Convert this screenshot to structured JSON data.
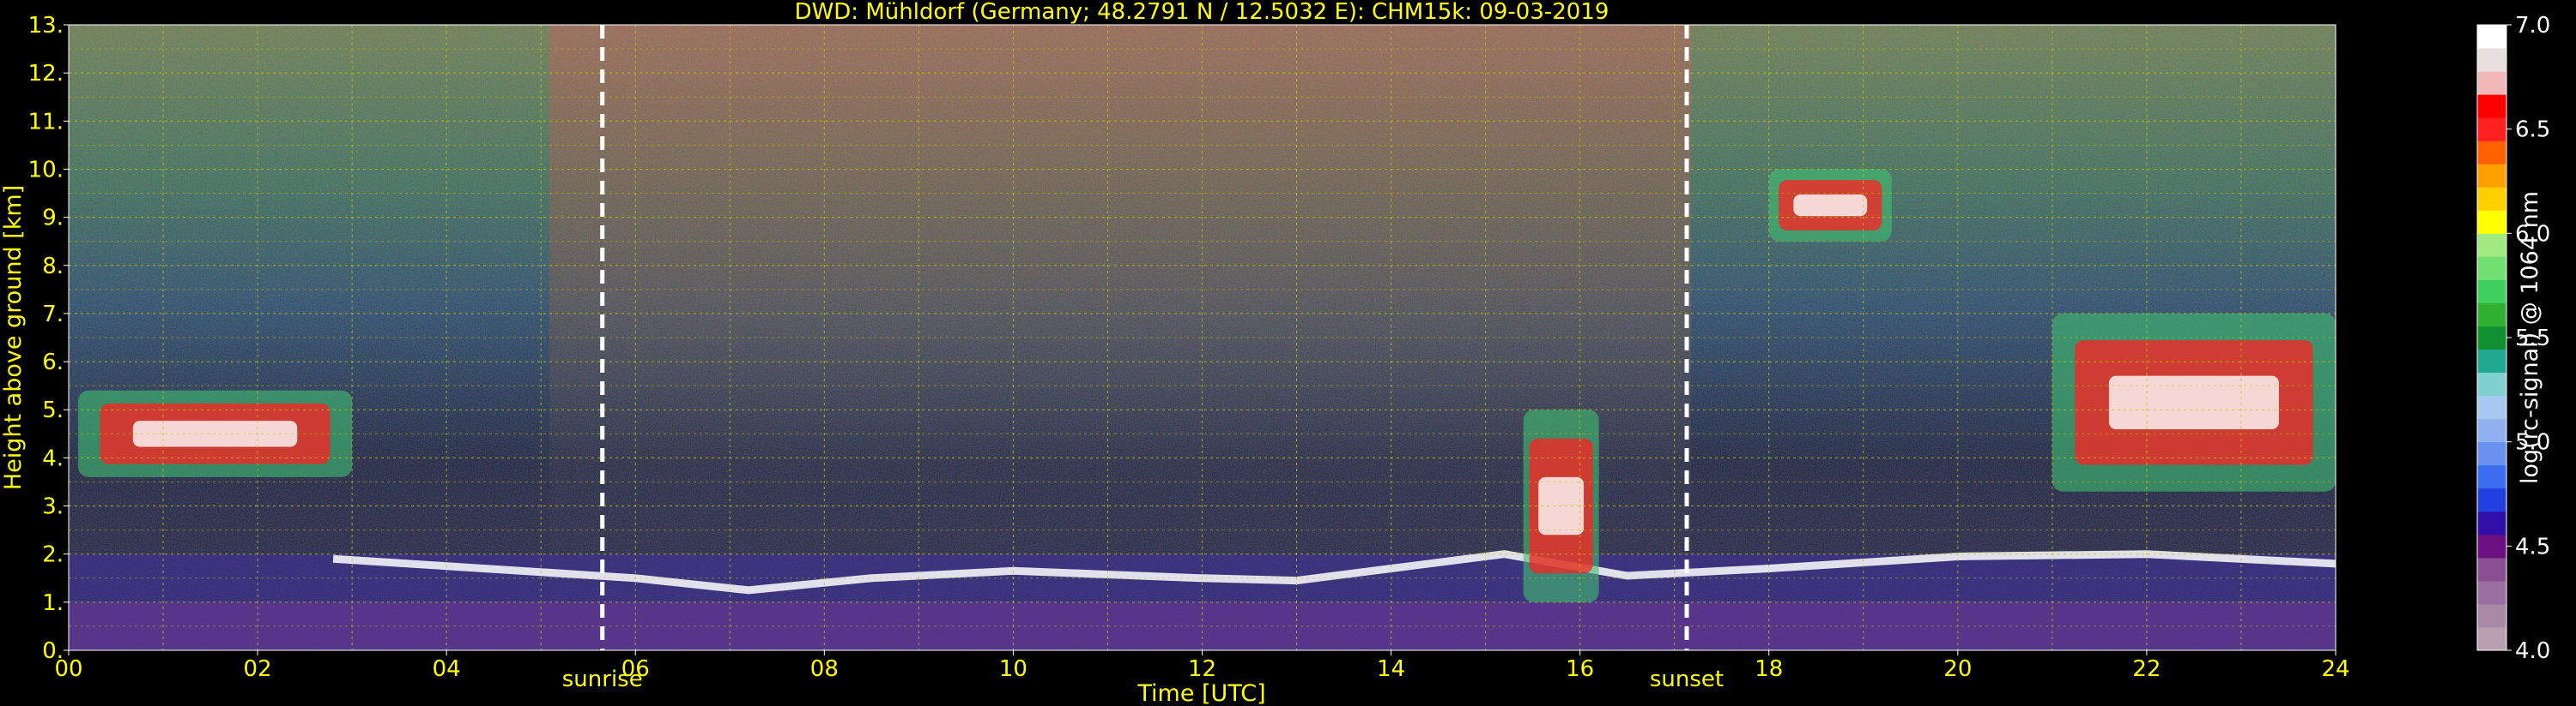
{
  "chart_data": {
    "type": "heatmap",
    "title": "DWD: Mühldorf (Germany; 48.2791 N / 12.5032 E):    CHM15k: 09-03-2019",
    "xlabel": "Time [UTC]",
    "ylabel": "Height above ground [km]",
    "xlim": [
      0,
      24
    ],
    "ylim": [
      0,
      13
    ],
    "x_ticks": [
      "00",
      "02",
      "04",
      "06",
      "08",
      "10",
      "12",
      "14",
      "16",
      "18",
      "20",
      "22",
      "24"
    ],
    "y_ticks": [
      "0.",
      "1.",
      "2.",
      "3.",
      "4.",
      "5.",
      "6.",
      "7.",
      "8.",
      "9.",
      "10.",
      "11.",
      "12.",
      "13."
    ],
    "grid": true,
    "colorbar": {
      "label": "log(rc-signal) @ 1064 nm",
      "range": [
        4.0,
        7.0
      ],
      "ticks": [
        "4.0",
        "4.5",
        "5.0",
        "5.5",
        "6.0",
        "6.5",
        "7.0"
      ],
      "colors": [
        "#b8a0b0",
        "#a88aa6",
        "#9a6fa0",
        "#8a4f92",
        "#6a1080",
        "#3010a8",
        "#2040e0",
        "#3c6cf0",
        "#6a90f0",
        "#90b0f0",
        "#a8c8f0",
        "#80d0d0",
        "#20a890",
        "#109030",
        "#30b030",
        "#40d060",
        "#70e070",
        "#a0e880",
        "#ffff00",
        "#ffd000",
        "#ffa000",
        "#ff6000",
        "#ff2020",
        "#ff0000",
        "#f0b8b8",
        "#e8e0e0",
        "#ffffff"
      ]
    },
    "annotations": [
      {
        "label": "sunrise",
        "x": 5.65
      },
      {
        "label": "sunset",
        "x": 17.13
      }
    ],
    "features": [
      {
        "name": "boundary_layer_top",
        "points": [
          [
            2.8,
            1.9
          ],
          [
            4,
            1.75
          ],
          [
            6,
            1.5
          ],
          [
            7.2,
            1.25
          ],
          [
            8.5,
            1.5
          ],
          [
            10,
            1.65
          ],
          [
            12,
            1.5
          ],
          [
            13,
            1.45
          ],
          [
            14,
            1.7
          ],
          [
            15.2,
            2.0
          ],
          [
            16.5,
            1.55
          ],
          [
            18,
            1.7
          ],
          [
            20,
            1.95
          ],
          [
            22,
            2.0
          ],
          [
            24,
            1.8
          ]
        ]
      },
      {
        "name": "cloud_layer_morning",
        "x": [
          0.1,
          3.0
        ],
        "y": [
          3.6,
          5.4
        ]
      },
      {
        "name": "cloud_layer_afternoon",
        "x": [
          15.4,
          16.2
        ],
        "y": [
          1.0,
          5.0
        ]
      },
      {
        "name": "cloud_layer_evening_high",
        "x": [
          18.0,
          19.3
        ],
        "y": [
          8.5,
          10.0
        ]
      },
      {
        "name": "cloud_layer_night",
        "x": [
          21.0,
          24.0
        ],
        "y": [
          3.3,
          7.0
        ]
      }
    ]
  }
}
